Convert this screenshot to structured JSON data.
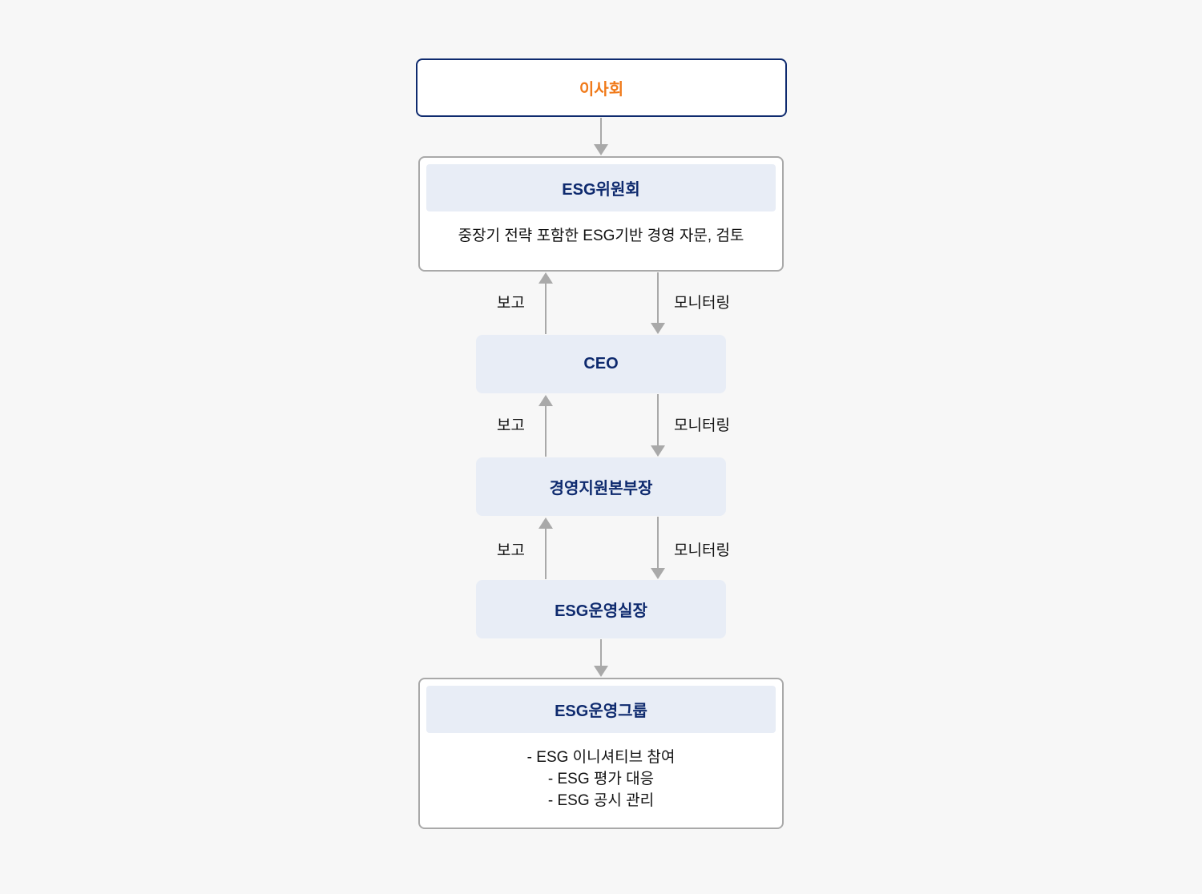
{
  "board": {
    "label": "이사회"
  },
  "committee": {
    "title": "ESG위원회",
    "description": "중장기 전략 포함한 ESG기반 경영 자문, 검토"
  },
  "ceo": {
    "label": "CEO"
  },
  "division_head": {
    "label": "경영지원본부장"
  },
  "esg_ops_head": {
    "label": "ESG운영실장"
  },
  "esg_group": {
    "title": "ESG운영그룹",
    "items": [
      "- ESG 이니셔티브 참여",
      "- ESG 평가 대응",
      "- ESG 공시 관리"
    ]
  },
  "connectors": {
    "report_label": "보고",
    "monitoring_label": "모니터링"
  },
  "colors": {
    "accent_orange": "#f07a1a",
    "navy": "#0e2a6e",
    "node_fill": "#e8edf6",
    "arrow": "#a9a9a9"
  }
}
